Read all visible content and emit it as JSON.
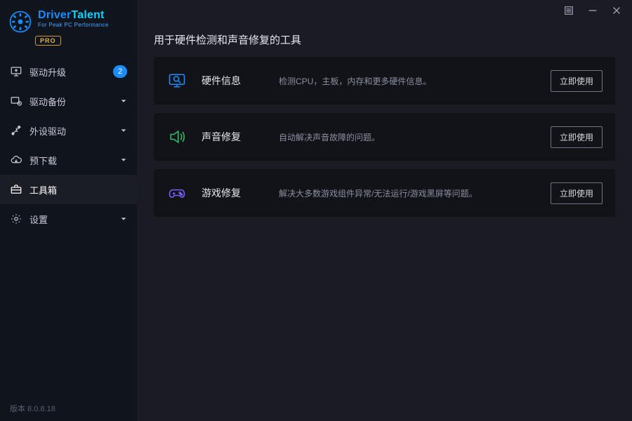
{
  "logo": {
    "title_a": "Driver",
    "title_b": "Talent",
    "subtitle": "For Peak PC Performance",
    "pro": "PRO"
  },
  "sidebar": {
    "items": [
      {
        "label": "驱动升级",
        "badge": "2"
      },
      {
        "label": "驱动备份"
      },
      {
        "label": "外设驱动"
      },
      {
        "label": "预下载"
      },
      {
        "label": "工具箱"
      },
      {
        "label": "设置"
      }
    ],
    "version": "版本 8.0.8.18"
  },
  "page": {
    "title": "用于硬件检测和声音修复的工具",
    "tools": [
      {
        "name": "硬件信息",
        "desc": "检测CPU，主板，内存和更多硬件信息。",
        "action": "立即使用"
      },
      {
        "name": "声音修复",
        "desc": "自动解决声音故障的问题。",
        "action": "立即使用"
      },
      {
        "name": "游戏修复",
        "desc": "解决大多数游戏组件异常/无法运行/游戏黑屏等问题。",
        "action": "立即使用"
      }
    ]
  }
}
